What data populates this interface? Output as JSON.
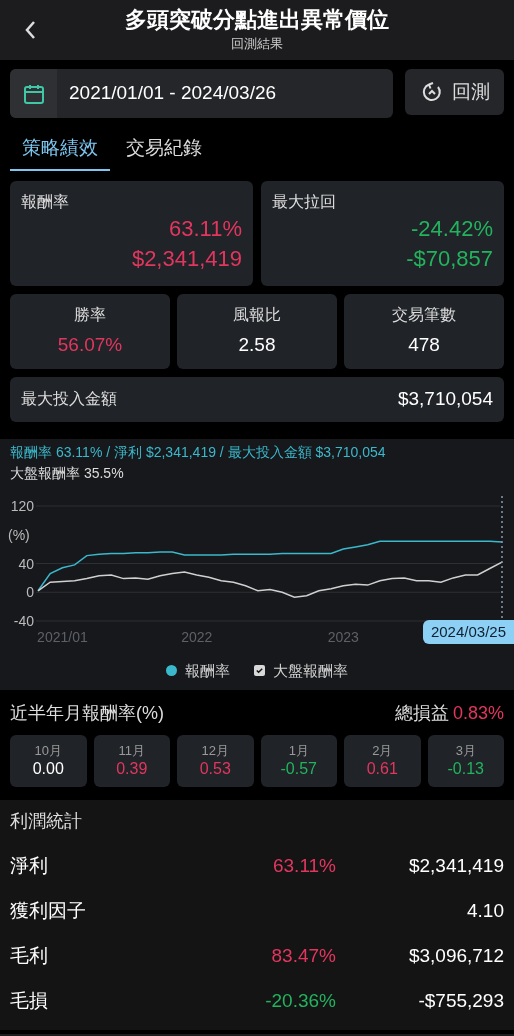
{
  "header": {
    "title": "多頭突破分點進出異常價位",
    "subtitle": "回測結果"
  },
  "date_range": {
    "value": "2021/01/01 - 2024/03/26"
  },
  "backtest_button": {
    "label": "回測"
  },
  "tabs": [
    {
      "label": "策略績效",
      "selected": true
    },
    {
      "label": "交易紀錄",
      "selected": false
    }
  ],
  "top_cards": [
    {
      "label": "報酬率",
      "values": [
        "63.11%",
        "$2,341,419"
      ],
      "color": "#e2365e"
    },
    {
      "label": "最大拉回",
      "values": [
        "-24.42%",
        "-$70,857"
      ],
      "color": "#22b35e"
    }
  ],
  "mid_cards": [
    {
      "label": "勝率",
      "value": "56.07%",
      "color": "#e2365e"
    },
    {
      "label": "風報比",
      "value": "2.58",
      "color": "#ffffff"
    },
    {
      "label": "交易筆數",
      "value": "478",
      "color": "#ffffff"
    }
  ],
  "max_investment": {
    "label": "最大投入金額",
    "value": "$3,710,054"
  },
  "chart_summary": {
    "strategy": "報酬率 63.11% / 淨利 $2,341,419 / 最大投入金額 $3,710,054",
    "benchmark": "大盤報酬率 35.5%"
  },
  "chart": {
    "tooltip": "2024/03/25",
    "legend": [
      {
        "kind": "dot"
      },
      {
        "kind": "checkbox",
        "checked": true
      }
    ],
    "chart_data": {
      "type": "line",
      "legend": "bottom",
      "ylabel": "(%)",
      "ylim": [
        -40,
        120
      ],
      "yticks": [
        -40,
        0,
        40,
        120
      ],
      "categories": [
        null,
        null,
        "2021/01",
        null,
        null,
        null,
        null,
        null,
        null,
        null,
        null,
        null,
        null,
        "2022",
        null,
        null,
        null,
        null,
        null,
        null,
        null,
        null,
        null,
        null,
        null,
        "2023",
        null,
        null,
        null,
        null,
        null,
        null,
        null,
        null,
        null,
        null,
        null,
        null,
        null
      ],
      "series": [
        {
          "name": "報酬率",
          "color": "#3ab8cc",
          "values": [
            2,
            26,
            34,
            38,
            51,
            53,
            54,
            54,
            55,
            55,
            56,
            56,
            52,
            52,
            52,
            52,
            53,
            53,
            53,
            53,
            54,
            54,
            54,
            54,
            54,
            60,
            63,
            66,
            71,
            71,
            71,
            71,
            71,
            71,
            71,
            71,
            71,
            71,
            70
          ]
        },
        {
          "name": "大盤報酬率",
          "color": "#d0d0d0",
          "values": [
            2,
            14,
            15,
            16,
            19,
            23,
            24,
            19,
            20,
            18,
            23,
            26,
            28,
            24,
            21,
            16,
            14,
            9,
            2,
            4,
            0,
            -7,
            -5,
            2,
            5,
            9,
            11,
            10,
            16,
            19,
            20,
            16,
            16,
            14,
            20,
            24,
            24,
            33,
            42
          ]
        }
      ]
    }
  },
  "monthly": {
    "title": "近半年月報酬率(%)",
    "total": {
      "label": "總損益",
      "value": "0.83%",
      "color": "#e2365e"
    },
    "months": [
      {
        "label": "10月",
        "value": "0.00",
        "color": "#ffffff"
      },
      {
        "label": "11月",
        "value": "0.39",
        "color": "#e2365e"
      },
      {
        "label": "12月",
        "value": "0.53",
        "color": "#e2365e"
      },
      {
        "label": "1月",
        "value": "-0.57",
        "color": "#22b35e"
      },
      {
        "label": "2月",
        "value": "0.61",
        "color": "#e2365e"
      },
      {
        "label": "3月",
        "value": "-0.13",
        "color": "#22b35e"
      }
    ]
  },
  "profit_stats": {
    "title": "利潤統計",
    "rows": [
      {
        "label": "淨利",
        "percent": "63.11%",
        "color": "#e2365e",
        "amount": "$2,341,419"
      },
      {
        "label": "獲利因子",
        "amount": "4.10"
      },
      {
        "label": "毛利",
        "percent": "83.47%",
        "color": "#e2365e",
        "amount": "$3,096,712"
      },
      {
        "label": "毛損",
        "percent": "-20.36%",
        "color": "#22b35e",
        "amount": "-$755,293"
      }
    ]
  }
}
